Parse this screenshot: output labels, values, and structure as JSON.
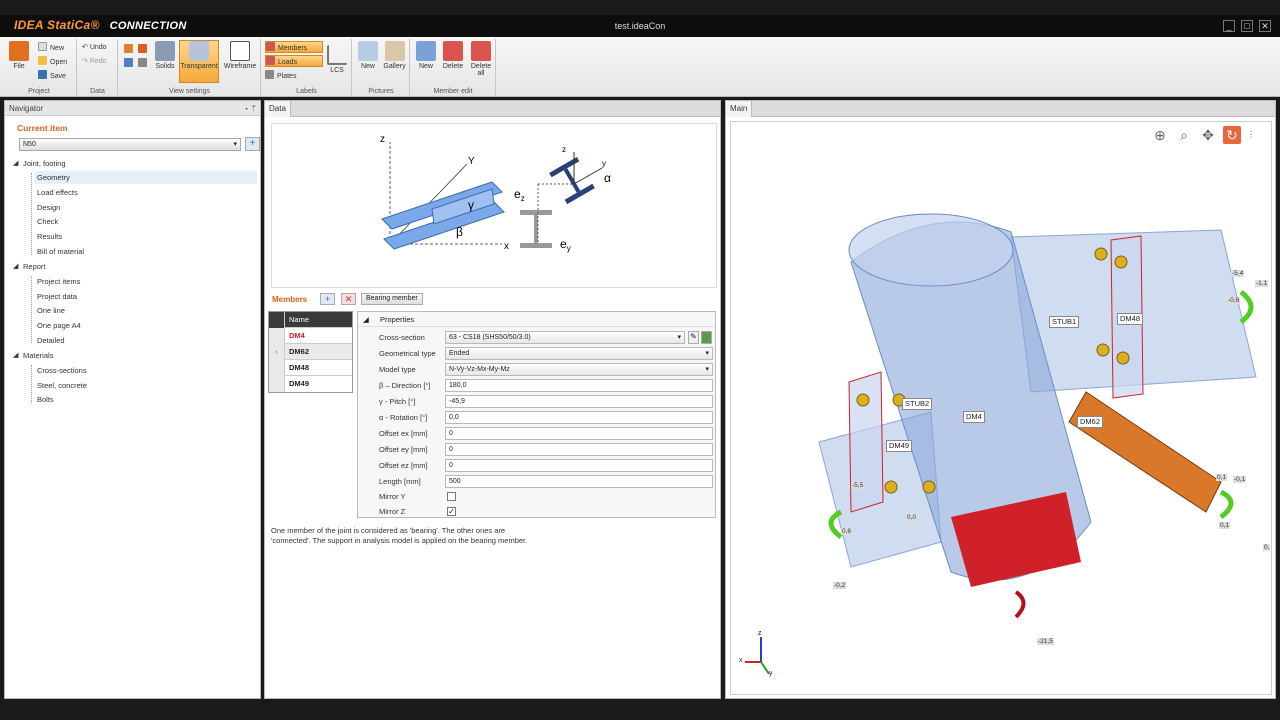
{
  "app": {
    "brand": "IDEA StatiCa®",
    "product": "CONNECTION",
    "doc_title": "test.ideaCon"
  },
  "ribbon": {
    "groups": {
      "project": "Project",
      "data": "Data",
      "view": "View settings",
      "labels": "Labels",
      "pictures": "Pictures",
      "member_edit": "Member edit"
    },
    "file": "File",
    "new": "New",
    "open": "Open",
    "save": "Save",
    "undo": "Undo",
    "redo": "Redo",
    "solids": "Solids",
    "transparent": "Transparent",
    "wireframe": "Wireframe",
    "members": "Members",
    "loads": "Loads",
    "plates": "Plates",
    "lcs": "LCS",
    "pic_new": "New",
    "gallery": "Gallery",
    "me_new": "New",
    "delete": "Delete",
    "delete_all": "Delete all"
  },
  "navigator": {
    "title": "Navigator",
    "current_item": "Current item",
    "item_value": "N50",
    "joint": "Joint, footing",
    "joint_items": [
      "Geometry",
      "Load effects",
      "Design",
      "Check",
      "Results",
      "Bill of material"
    ],
    "report": "Report",
    "report_items": [
      "Project items",
      "Project data",
      "One line",
      "One page A4",
      "Detailed"
    ],
    "materials": "Materials",
    "material_items": [
      "Cross-sections",
      "Steel, concrete",
      "Bolts"
    ]
  },
  "data_panel": {
    "tab": "Data",
    "figure": {
      "z": "z",
      "y": "Y",
      "x": "x",
      "gamma": "γ",
      "beta": "β",
      "z2": "z",
      "y2": "y",
      "alpha": "α",
      "ez": "e",
      "ez_sub": "z",
      "ey": "e",
      "ey_sub": "y"
    },
    "members_label": "Members",
    "bearing_btn": "Bearing member",
    "table_header": "Name",
    "members": [
      "DM4",
      "DM62",
      "DM48",
      "DM49"
    ],
    "properties_header": "Properties",
    "props": [
      {
        "label": "Cross-section",
        "value": "63 - CS18 (SHS50/50/3.0)"
      },
      {
        "label": "Geometrical type",
        "value": "Ended"
      },
      {
        "label": "Model type",
        "value": "N-Vy-Vz-Mx-My-Mz"
      },
      {
        "label": "β – Direction [°]",
        "value": "180,0"
      },
      {
        "label": "γ - Pitch [°]",
        "value": "-45,9"
      },
      {
        "label": "α - Rotation [°]",
        "value": "0,0"
      },
      {
        "label": "Offset ex [mm]",
        "value": "0"
      },
      {
        "label": "Offset ey [mm]",
        "value": "0"
      },
      {
        "label": "Offset ez [mm]",
        "value": "0"
      },
      {
        "label": "Length [mm]",
        "value": "500"
      },
      {
        "label": "Mirror Y",
        "value": ""
      },
      {
        "label": "Mirror Z",
        "value": "✓"
      }
    ],
    "note": "One member of the joint is considered as 'bearing'. The other ones are 'connected'. The support in analysis model is applied on the bearing member."
  },
  "main_panel": {
    "tab": "Main",
    "labels": {
      "stub1": "STUB1",
      "stub2": "STUB2",
      "dm4": "DM4",
      "dm48": "DM48",
      "dm49": "DM49",
      "dm62": "DM62"
    },
    "values": [
      "-5,4",
      "-1,1",
      "-0,6",
      "-5,5",
      "0,0",
      "0,6",
      "-0,2",
      "-21,5",
      "0,1",
      "-0,1",
      "0,1",
      "0,"
    ],
    "axis": {
      "z": "z",
      "x": "x",
      "y": "y"
    }
  },
  "colors": {
    "accent": "#e0601a",
    "ribbon_active": "#f5a83a",
    "member_red": "#d0202a",
    "member_orange": "#d9782a",
    "column_blue": "#8aa6d8"
  }
}
